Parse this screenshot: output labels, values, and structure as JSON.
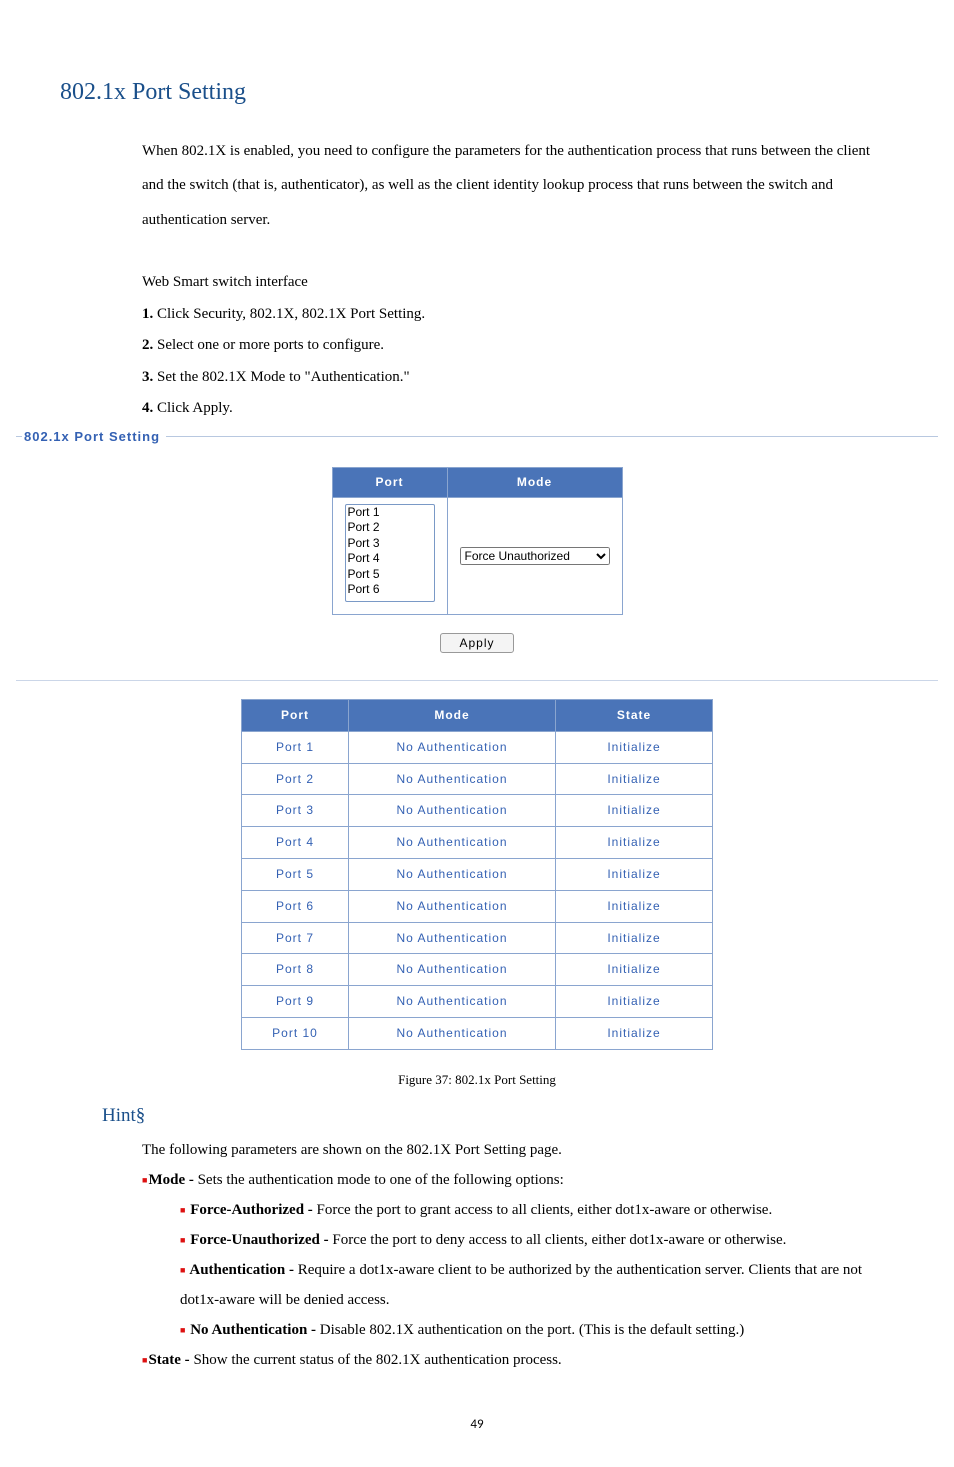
{
  "title": "802.1x Port Setting",
  "intro": "When 802.1X is enabled, you need to configure the parameters for the authentication process that runs between the client and the switch (that is, authenticator), as well as the client identity lookup process that runs between the switch and authentication server.",
  "interface_label": "Web Smart switch interface",
  "steps": [
    {
      "num": "1.",
      "text": " Click Security, 802.1X, 802.1X Port Setting."
    },
    {
      "num": "2.",
      "text": " Select one or more ports to configure."
    },
    {
      "num": "3.",
      "text": " Set the 802.1X Mode to \"Authentication.\""
    },
    {
      "num": "4.",
      "text": " Click Apply."
    }
  ],
  "panel": {
    "legend": "802.1x Port Setting",
    "headers": {
      "port": "Port",
      "mode": "Mode",
      "state": "State"
    },
    "port_options": [
      "Port 1",
      "Port 2",
      "Port 3",
      "Port 4",
      "Port 5",
      "Port 6"
    ],
    "mode_selected": "Force Unauthorized",
    "apply_label": "Apply",
    "status_rows": [
      {
        "port": "Port 1",
        "mode": "No Authentication",
        "state": "Initialize"
      },
      {
        "port": "Port 2",
        "mode": "No Authentication",
        "state": "Initialize"
      },
      {
        "port": "Port 3",
        "mode": "No Authentication",
        "state": "Initialize"
      },
      {
        "port": "Port 4",
        "mode": "No Authentication",
        "state": "Initialize"
      },
      {
        "port": "Port 5",
        "mode": "No Authentication",
        "state": "Initialize"
      },
      {
        "port": "Port 6",
        "mode": "No Authentication",
        "state": "Initialize"
      },
      {
        "port": "Port 7",
        "mode": "No Authentication",
        "state": "Initialize"
      },
      {
        "port": "Port 8",
        "mode": "No Authentication",
        "state": "Initialize"
      },
      {
        "port": "Port 9",
        "mode": "No Authentication",
        "state": "Initialize"
      },
      {
        "port": "Port 10",
        "mode": "No Authentication",
        "state": "Initialize"
      }
    ]
  },
  "figure_caption": "Figure 37: 802.1x Port Setting",
  "hint": {
    "title": "Hint§",
    "intro": "The following parameters are shown on the 802.1X Port Setting page.",
    "mode_label": "Mode - ",
    "mode_text": "Sets the authentication mode to one of the following options:",
    "options": [
      {
        "label": "Force-Authorized - ",
        "text": "Force the port to grant access to all clients, either dot1x-aware or otherwise."
      },
      {
        "label": "Force-Unauthorized - ",
        "text": "Force the port to deny access to all clients, either dot1x-aware or otherwise."
      },
      {
        "label": "Authentication - ",
        "text": "Require a dot1x-aware client to be authorized by the authentication server. Clients that are not dot1x-aware will be denied access."
      },
      {
        "label": "No Authentication - ",
        "text": "Disable 802.1X authentication on the port. (This is the default setting.)"
      }
    ],
    "state_label": "State - ",
    "state_text": "Show the current status of the 802.1X authentication process."
  },
  "page_number": "49"
}
